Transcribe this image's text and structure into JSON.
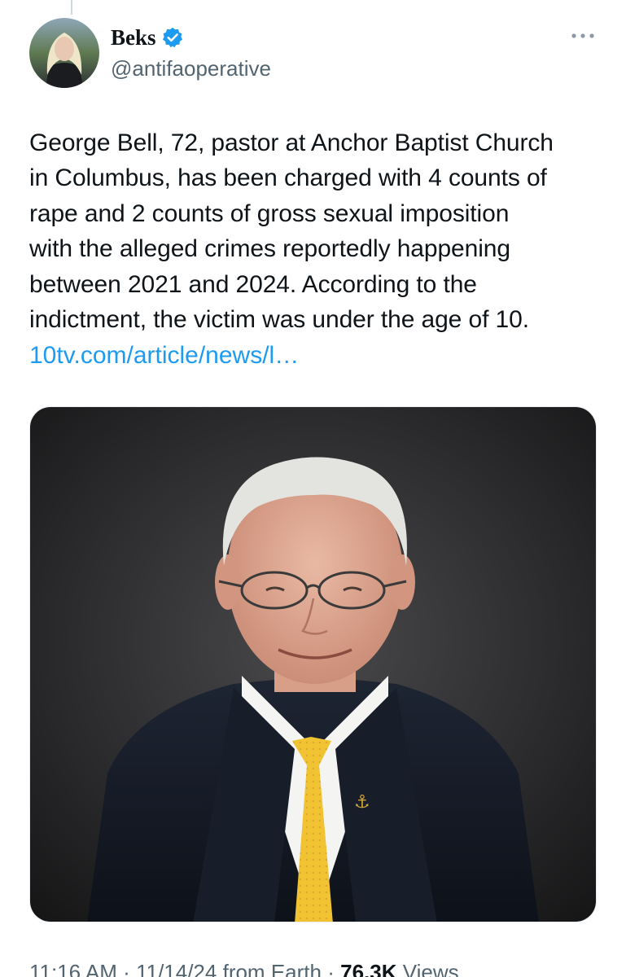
{
  "author": {
    "display_name": "Beks",
    "handle": "@antifaoperative",
    "verified": true,
    "verified_color": "#1d9bf0"
  },
  "tweet": {
    "text": "George Bell, 72, pastor at Anchor Baptist Church\nin Columbus, has been charged with 4 counts of\nrape and 2 counts of gross sexual imposition\nwith the alleged crimes reportedly happening\nbetween 2021 and 2024. According to the\nindictment, the victim was under the age of 10.",
    "link": "10tv.com/article/news/l…",
    "link_color": "#1d9bf0"
  },
  "media": {
    "icon": "photo-icon"
  },
  "meta": {
    "time": "11:16 AM",
    "separator": "·",
    "date": "11/14/24",
    "source": "from Earth",
    "views_count": "76.3K",
    "views_label": "Views"
  },
  "icons": {
    "more": "more-options-icon",
    "verified": "verified-badge-icon"
  }
}
